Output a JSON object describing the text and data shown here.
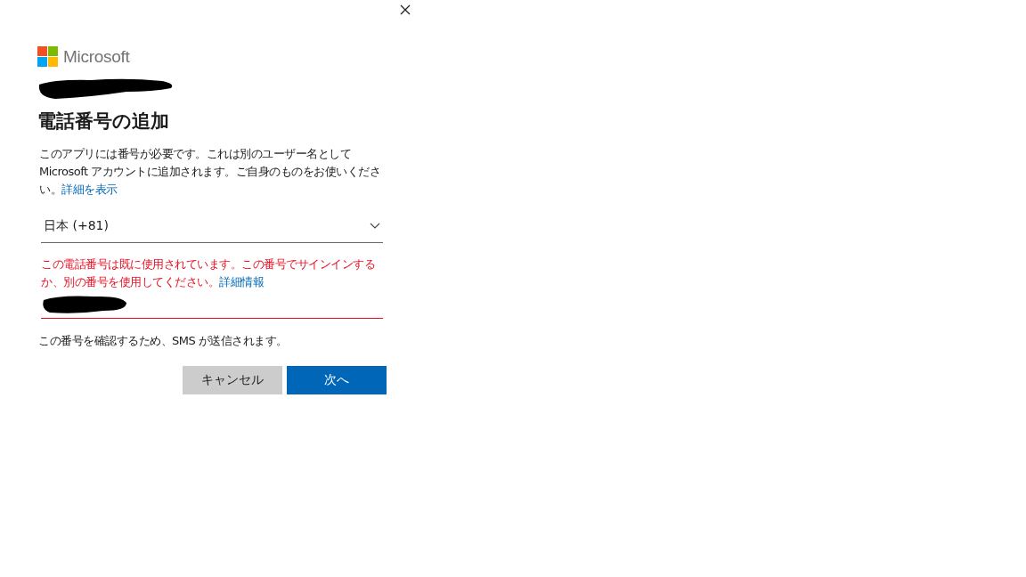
{
  "brand": {
    "name": "Microsoft"
  },
  "account": {
    "redacted": true
  },
  "title": "電話番号の追加",
  "description": {
    "text": "このアプリには番号が必要です。これは別のユーザー名として Microsoft アカウントに追加されます。ご自身のものをお使いください。",
    "link": "詳細を表示"
  },
  "country_select": {
    "value": "日本 (+81)"
  },
  "error": {
    "text": "この電話番号は既に使用されています。この番号でサインインするか、別の番号を使用してください。",
    "link": "詳細情報"
  },
  "phone_field": {
    "redacted": true,
    "error": true
  },
  "note": "この番号を確認するため、SMS が送信されます。",
  "buttons": [
    {
      "label": "キャンセル",
      "kind": "secondary"
    },
    {
      "label": "次へ",
      "kind": "primary"
    }
  ]
}
